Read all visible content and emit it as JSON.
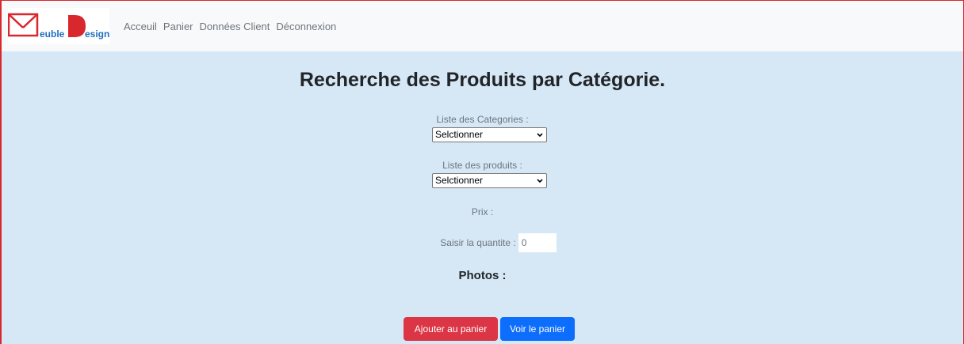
{
  "brand": {
    "logo_text_1": "euble",
    "logo_text_2": "esign",
    "logo_letter": "D",
    "logo_color": "#d9272e",
    "logo_text_color": "#1f6fbf"
  },
  "nav": {
    "items": [
      {
        "label": "Acceuil"
      },
      {
        "label": "Panier"
      },
      {
        "label": "Données Client"
      },
      {
        "label": "Déconnexion"
      }
    ]
  },
  "main": {
    "title": "Recherche des Produits par Catégorie.",
    "categories_label": "Liste des Categories :",
    "categories_selected": "Selctionner",
    "products_label": "Liste des produits :",
    "products_selected": "Selctionner",
    "price_label": "Prix :",
    "quantity_label": "Saisir la quantite :",
    "quantity_value": "0",
    "photos_label": "Photos :",
    "add_to_cart_label": "Ajouter au panier",
    "view_cart_label": "Voir le panier"
  },
  "colors": {
    "background": "#d6e8f6",
    "navbar": "#f8f9fa",
    "danger": "#dc3545",
    "primary": "#0d6efd"
  },
  "icons": [
    "logo-icon",
    "chevron-down-icon"
  ]
}
